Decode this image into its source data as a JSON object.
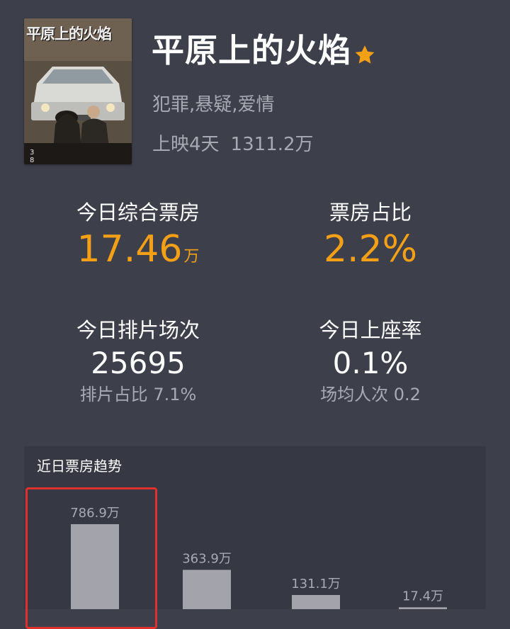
{
  "movie": {
    "poster_title": "平原上的火焰",
    "title": "平原上的火焰",
    "genres": "犯罪,悬疑,爱情",
    "release_days": "上映4天",
    "total_box_office": "1311.2万"
  },
  "stats": {
    "today_box_office": {
      "label": "今日综合票房",
      "value": "17.46",
      "unit": "万"
    },
    "box_office_share": {
      "label": "票房占比",
      "value": "2.2%"
    },
    "screenings": {
      "label": "今日排片场次",
      "value": "25695",
      "sub": "排片占比 7.1%"
    },
    "occupancy": {
      "label": "今日上座率",
      "value": "0.1%",
      "sub": "场均人次 0.2"
    }
  },
  "trend": {
    "title": "近日票房趋势"
  },
  "colors": {
    "background": "#3d3f4b",
    "panel": "#363844",
    "accent_orange": "#f4a017",
    "highlight_red": "#e0302b",
    "bar_gray": "#a3a4ab",
    "muted_text": "#a7a9b3"
  },
  "chart_data": {
    "type": "bar",
    "title": "近日票房趋势",
    "unit": "万",
    "values": [
      786.9,
      363.9,
      131.1,
      17.4
    ],
    "labels": [
      "786.9万",
      "363.9万",
      "131.1万",
      "17.4万"
    ],
    "highlighted_index": 0
  }
}
